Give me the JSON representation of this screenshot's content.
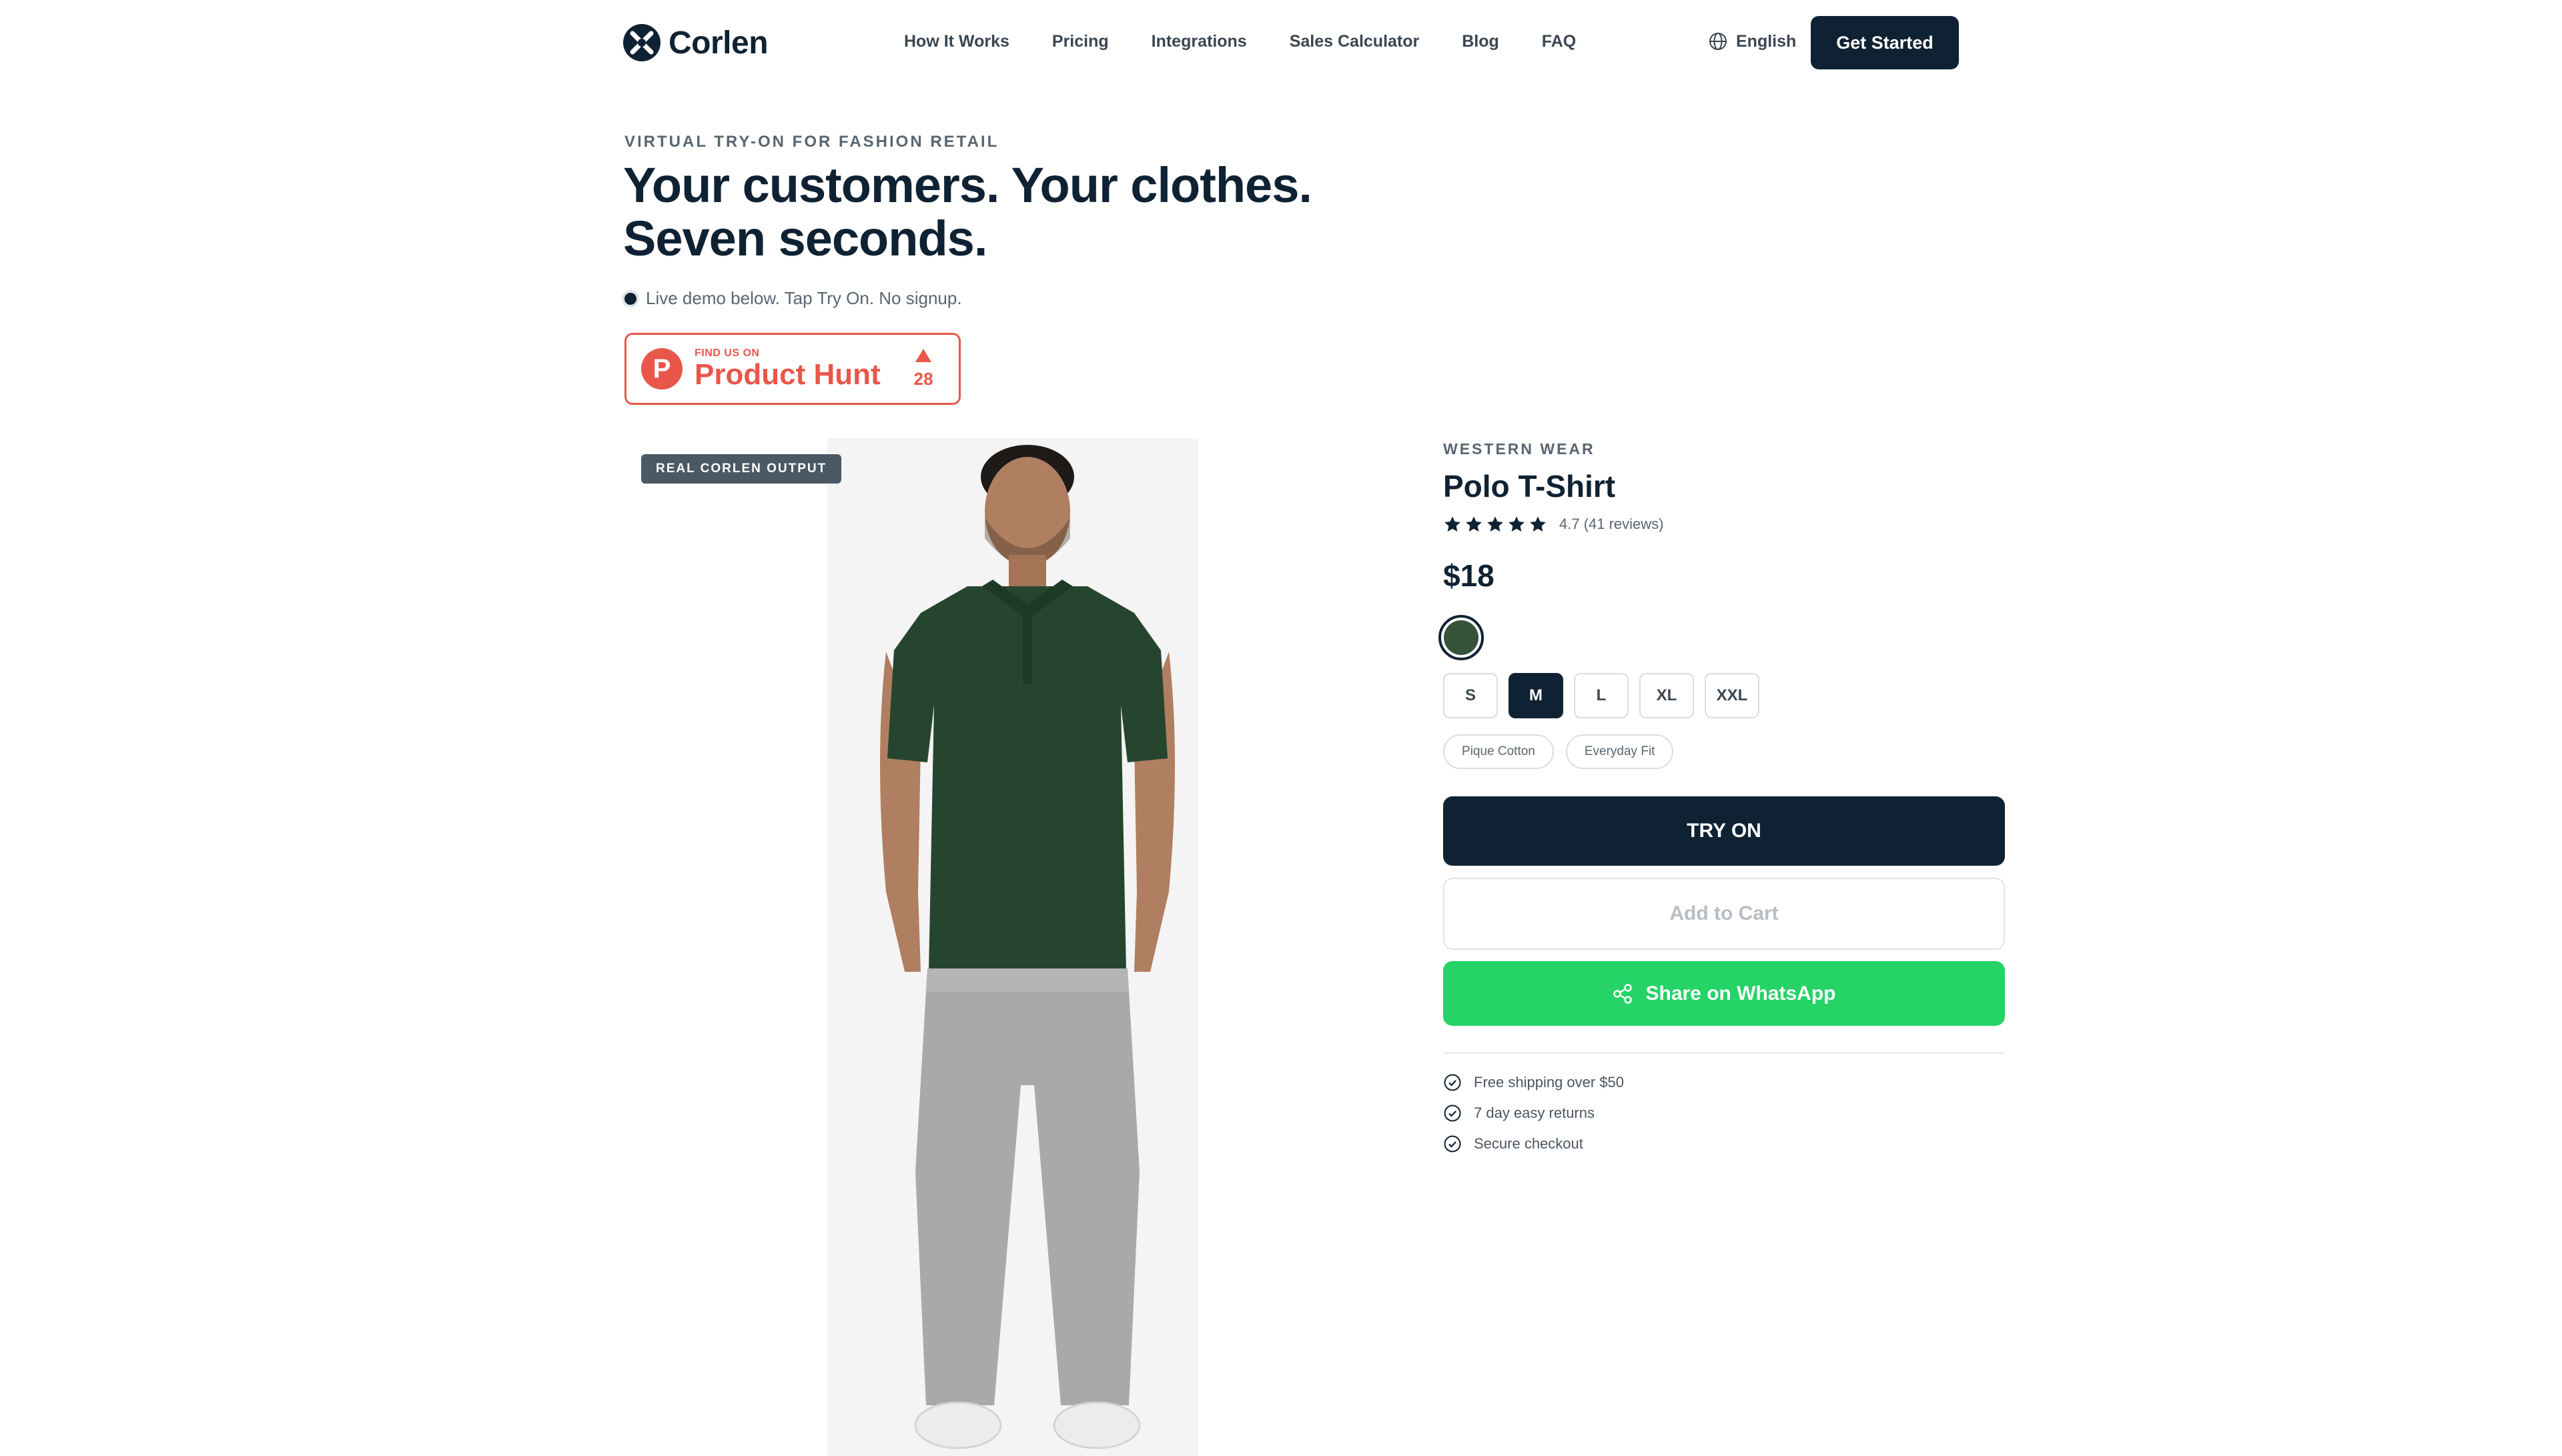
{
  "nav": {
    "brand": "Corlen",
    "links": [
      "How It Works",
      "Pricing",
      "Integrations",
      "Sales Calculator",
      "Blog",
      "FAQ"
    ],
    "language": "English",
    "cta": "Get Started"
  },
  "hero": {
    "eyebrow": "VIRTUAL TRY-ON FOR FASHION RETAIL",
    "headline": "Your customers. Your clothes. Seven seconds.",
    "demo_note": "Live demo below. Tap Try On. No signup.",
    "product_hunt": {
      "small": "FIND US ON",
      "big": "Product Hunt",
      "votes": "28"
    }
  },
  "preview": {
    "badge": "REAL CORLEN OUTPUT"
  },
  "product": {
    "category": "WESTERN WEAR",
    "name": "Polo T-Shirt",
    "rating_value": 4.7,
    "rating_text": "4.7 (41 reviews)",
    "price": "$18",
    "color": "#365239",
    "sizes": [
      "S",
      "M",
      "L",
      "XL",
      "XXL"
    ],
    "selected_size": "M",
    "tags": [
      "Pique Cotton",
      "Everyday Fit"
    ],
    "try_on": "TRY ON",
    "add_to_cart": "Add to Cart",
    "share": "Share on WhatsApp",
    "perks": [
      "Free shipping over $50",
      "7 day easy returns",
      "Secure checkout"
    ]
  },
  "colors": {
    "navy": "#0f2233",
    "product_hunt": "#e8574a",
    "whatsapp": "#25d366"
  }
}
